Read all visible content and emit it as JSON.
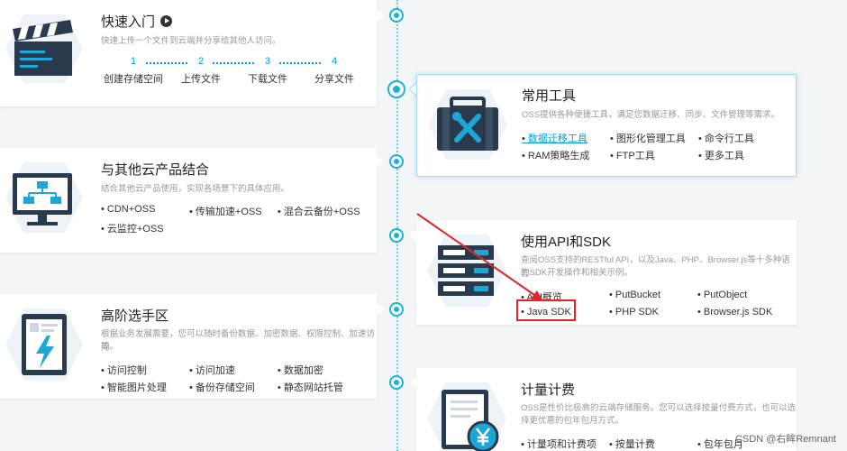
{
  "quickstart": {
    "title": "快速入门",
    "desc": "快速上传一个文件到云端并分享给其他人访问。",
    "steps": [
      {
        "num": "1",
        "label": "创建存储空间"
      },
      {
        "num": "2",
        "label": "上传文件"
      },
      {
        "num": "3",
        "label": "下载文件"
      },
      {
        "num": "4",
        "label": "分享文件"
      }
    ]
  },
  "tools": {
    "title": "常用工具",
    "desc": "OSS提供各种便捷工具，满足您数据迁移、同步、文件管理等需求。",
    "links": [
      "数据迁移工具",
      "图形化管理工具",
      "命令行工具",
      "RAM策略生成",
      "FTP工具",
      "更多工具"
    ]
  },
  "cloud": {
    "title": "与其他云产品结合",
    "desc": "结合其他云产品使用，实现各场景下的具体应用。",
    "links": [
      "CDN+OSS",
      "传输加速+OSS",
      "混合云备份+OSS",
      "云监控+OSS"
    ]
  },
  "api": {
    "title": "使用API和SDK",
    "desc_line1": "查阅OSS支持的RESTful API，以及Java、PHP、Browser.js等十多种语言",
    "desc_line2": "的SDK开发操作和相关示例。",
    "links": [
      "API概览",
      "PutBucket",
      "PutObject",
      "Java SDK",
      "PHP SDK",
      "Browser.js SDK"
    ]
  },
  "advanced": {
    "title": "高阶选手区",
    "desc_line1": "根据业务发展需要，您可以随时备份数据、加密数据、权限控制、加速访问",
    "desc_line2": "等。",
    "links": [
      "访问控制",
      "访问加速",
      "数据加密",
      "智能图片处理",
      "备份存储空间",
      "静态网站托管"
    ]
  },
  "billing": {
    "title": "计量计费",
    "desc_line1": "OSS是性价比极高的云端存储服务。您可以选择按量付费方式，也可以选",
    "desc_line2": "择更优惠的包年包月方式。",
    "links": [
      "计量项和计费项",
      "按量计费",
      "包年包月"
    ]
  },
  "watermark": "CSDN @右眸Remnant",
  "colors": {
    "accent": "#00a2d4",
    "highlight": "#e0262b",
    "timeline": "#19b3d6"
  }
}
